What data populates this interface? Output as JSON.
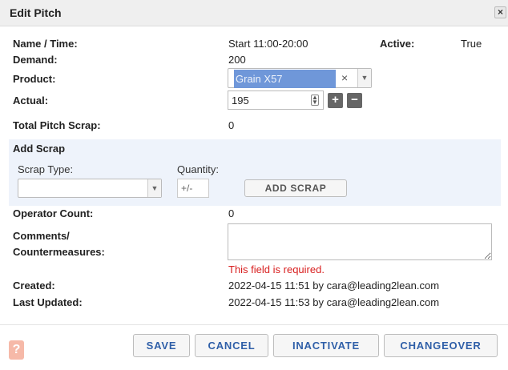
{
  "dialog": {
    "title": "Edit Pitch"
  },
  "fields": {
    "name_time_label": "Name / Time:",
    "name_time_value": "Start 11:00-20:00",
    "active_label": "Active:",
    "active_value": "True",
    "demand_label": "Demand:",
    "demand_value": "200",
    "product_label": "Product:",
    "product_value": "Grain X57",
    "actual_label": "Actual:",
    "actual_value": "195",
    "total_scrap_label": "Total Pitch Scrap:",
    "total_scrap_value": "0"
  },
  "add_scrap": {
    "title": "Add Scrap",
    "scrap_type_label": "Scrap Type:",
    "scrap_type_value": "",
    "quantity_label": "Quantity:",
    "quantity_placeholder": "+/-",
    "add_button": "ADD SCRAP"
  },
  "operator": {
    "label": "Operator Count:",
    "value": "0"
  },
  "comments": {
    "label_line1": "Comments/",
    "label_line2": "Countermeasures:",
    "value": "",
    "error": "This field is required."
  },
  "meta": {
    "created_label": "Created:",
    "created_value": "2022-04-15 11:51 by cara@leading2lean.com",
    "updated_label": "Last Updated:",
    "updated_value": "2022-04-15 11:53 by cara@leading2lean.com"
  },
  "footer": {
    "help": "?",
    "save": "SAVE",
    "cancel": "CANCEL",
    "inactivate": "INACTIVATE",
    "changeover": "CHANGEOVER"
  },
  "icons": {
    "close": "close-icon",
    "clear": "clear-icon",
    "dropdown": "chevron-down-icon",
    "spinner": "spinner-icon",
    "plus": "plus-icon",
    "minus": "minus-icon",
    "help": "help-icon"
  }
}
